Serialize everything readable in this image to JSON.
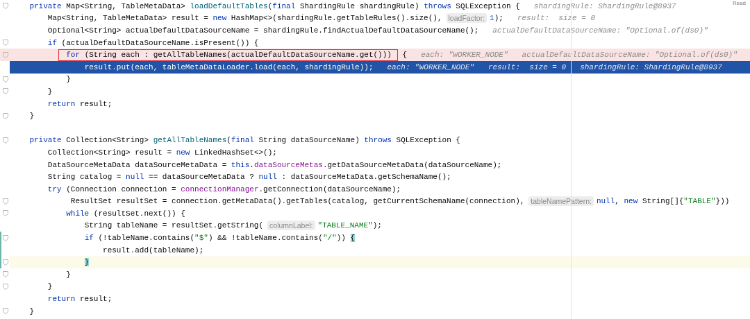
{
  "corner_label": "Read",
  "lines": [
    {
      "kind": "normal",
      "fold": true,
      "changed": false,
      "tokens": [
        {
          "kind": "kw",
          "text": "    private"
        },
        {
          "kind": "p",
          "text": " Map<String, TableMetaData> "
        },
        {
          "kind": "m",
          "text": "loadDefaultTables"
        },
        {
          "kind": "p",
          "text": "("
        },
        {
          "kind": "kw",
          "text": "final"
        },
        {
          "kind": "p",
          "text": " ShardingRule shardingRule) "
        },
        {
          "kind": "kw",
          "text": "throws"
        },
        {
          "kind": "p",
          "text": " SQLException {"
        },
        {
          "kind": "v",
          "text": "shardingRule: ShardingRule@8937"
        }
      ]
    },
    {
      "kind": "normal",
      "fold": false,
      "changed": false,
      "tokens": [
        {
          "kind": "p",
          "text": "        Map<String, TableMetaData> result = "
        },
        {
          "kind": "kw",
          "text": "new"
        },
        {
          "kind": "p",
          "text": " HashMap<>(shardingRule.getTableRules().size(),"
        },
        {
          "kind": "h",
          "text": "loadFactor:"
        },
        {
          "kind": "n",
          "text": "1"
        },
        {
          "kind": "p",
          "text": ");"
        },
        {
          "kind": "v",
          "text": "result:  size = 0"
        }
      ]
    },
    {
      "kind": "normal",
      "fold": false,
      "changed": false,
      "tokens": [
        {
          "kind": "p",
          "text": "        Optional<String> actualDefaultDataSourceName = shardingRule.findActualDefaultDataSourceName();"
        },
        {
          "kind": "v",
          "text": "actualDefaultDataSourceName: \"Optional.of(ds0)\""
        }
      ]
    },
    {
      "kind": "normal",
      "fold": true,
      "changed": false,
      "tokens": [
        {
          "kind": "kw",
          "text": "        if"
        },
        {
          "kind": "p",
          "text": " (actualDefaultDataSourceName.isPresent()) {"
        }
      ]
    },
    {
      "kind": "breakpoint",
      "fold": true,
      "changed": false,
      "tokens": [
        {
          "kind": "group",
          "outlined": true,
          "tokens": [
            {
              "kind": "kw",
              "text": "            for"
            },
            {
              "kind": "p",
              "text": " (String each : getAllTableNames(actualDefaultDataSourceName.get()))"
            }
          ]
        },
        {
          "kind": "p",
          "text": " {"
        },
        {
          "kind": "v",
          "text": "each: \"WORKER_NODE\""
        },
        {
          "kind": "v",
          "text": "actualDefaultDataSourceName: \"Optional.of(ds0)\""
        }
      ]
    },
    {
      "kind": "execution",
      "fold": false,
      "changed": false,
      "tokens": [
        {
          "kind": "p",
          "text": "                result.put(each, tableMetaDataLoader.load(each, shardingRule));"
        },
        {
          "kind": "v",
          "text": "each: \"WORKER_NODE\""
        },
        {
          "kind": "v",
          "text": "result:  size = 0"
        },
        {
          "kind": "v",
          "text": "shardingRule: ShardingRule@8937"
        }
      ]
    },
    {
      "kind": "normal",
      "fold": true,
      "changed": false,
      "tokens": [
        {
          "kind": "p",
          "text": "            }"
        }
      ]
    },
    {
      "kind": "normal",
      "fold": true,
      "changed": false,
      "tokens": [
        {
          "kind": "p",
          "text": "        }"
        }
      ]
    },
    {
      "kind": "normal",
      "fold": false,
      "changed": false,
      "tokens": [
        {
          "kind": "kw",
          "text": "        return"
        },
        {
          "kind": "p",
          "text": " result;"
        }
      ]
    },
    {
      "kind": "normal",
      "fold": true,
      "changed": false,
      "tokens": [
        {
          "kind": "p",
          "text": "    }"
        }
      ]
    },
    {
      "kind": "normal",
      "fold": false,
      "changed": false
    },
    {
      "kind": "normal",
      "fold": true,
      "changed": false,
      "tokens": [
        {
          "kind": "kw",
          "text": "    private"
        },
        {
          "kind": "p",
          "text": " Collection<String> "
        },
        {
          "kind": "m",
          "text": "getAllTableNames"
        },
        {
          "kind": "p",
          "text": "("
        },
        {
          "kind": "kw",
          "text": "final"
        },
        {
          "kind": "p",
          "text": " String dataSourceName) "
        },
        {
          "kind": "kw",
          "text": "throws"
        },
        {
          "kind": "p",
          "text": " SQLException {"
        }
      ]
    },
    {
      "kind": "normal",
      "fold": false,
      "changed": false,
      "tokens": [
        {
          "kind": "p",
          "text": "        Collection<String> result = "
        },
        {
          "kind": "kw",
          "text": "new"
        },
        {
          "kind": "p",
          "text": " LinkedHashSet<>();"
        }
      ]
    },
    {
      "kind": "normal",
      "fold": false,
      "changed": false,
      "tokens": [
        {
          "kind": "p",
          "text": "        DataSourceMetaData dataSourceMetaData = "
        },
        {
          "kind": "kw",
          "text": "this"
        },
        {
          "kind": "p",
          "text": "."
        },
        {
          "kind": "f",
          "text": "dataSourceMetas"
        },
        {
          "kind": "p",
          "text": ".getDataSourceMetaData(dataSourceName);"
        }
      ]
    },
    {
      "kind": "normal",
      "fold": false,
      "changed": false,
      "tokens": [
        {
          "kind": "p",
          "text": "        String catalog = "
        },
        {
          "kind": "kw",
          "text": "null"
        },
        {
          "kind": "p",
          "text": " == dataSourceMetaData ? "
        },
        {
          "kind": "kw",
          "text": "null"
        },
        {
          "kind": "p",
          "text": " : dataSourceMetaData.getSchemaName();"
        }
      ]
    },
    {
      "kind": "normal",
      "fold": false,
      "changed": false,
      "tokens": [
        {
          "kind": "kw",
          "text": "        try"
        },
        {
          "kind": "p",
          "text": " (Connection connection = "
        },
        {
          "kind": "f",
          "text": "connectionManager"
        },
        {
          "kind": "p",
          "text": ".getConnection(dataSourceName);"
        }
      ]
    },
    {
      "kind": "normal",
      "fold": true,
      "changed": false,
      "tokens": [
        {
          "kind": "p",
          "text": "             ResultSet resultSet = connection.getMetaData().getTables(catalog, getCurrentSchemaName(connection),"
        },
        {
          "kind": "h",
          "text": "tableNamePattern:"
        },
        {
          "kind": "kw",
          "text": "null"
        },
        {
          "kind": "p",
          "text": ", "
        },
        {
          "kind": "kw",
          "text": "new"
        },
        {
          "kind": "p",
          "text": " String[]{"
        },
        {
          "kind": "s",
          "text": "\"TABLE\""
        },
        {
          "kind": "p",
          "text": "}))"
        }
      ]
    },
    {
      "kind": "normal",
      "fold": true,
      "changed": false,
      "tokens": [
        {
          "kind": "kw",
          "text": "            while"
        },
        {
          "kind": "p",
          "text": " (resultSet.next()) {"
        }
      ]
    },
    {
      "kind": "normal",
      "fold": false,
      "changed": false,
      "tokens": [
        {
          "kind": "p",
          "text": "                String tableName = resultSet.getString("
        },
        {
          "kind": "h",
          "text": "columnLabel:"
        },
        {
          "kind": "s",
          "text": "\"TABLE_NAME\""
        },
        {
          "kind": "p",
          "text": ");"
        }
      ]
    },
    {
      "kind": "normal",
      "fold": true,
      "changed": true,
      "tokens": [
        {
          "kind": "kw",
          "text": "                if"
        },
        {
          "kind": "p",
          "text": " (!tableName.contains("
        },
        {
          "kind": "s",
          "text": "\"$\""
        },
        {
          "kind": "p",
          "text": ") && !tableName.contains("
        },
        {
          "kind": "s",
          "text": "\"/\""
        },
        {
          "kind": "p",
          "text": ")) "
        },
        {
          "kind": "b",
          "text": "{"
        }
      ]
    },
    {
      "kind": "normal",
      "fold": false,
      "changed": true,
      "tokens": [
        {
          "kind": "p",
          "text": "                    result.add(tableName);"
        }
      ]
    },
    {
      "kind": "caret",
      "fold": true,
      "changed": true,
      "tokens": [
        {
          "kind": "b",
          "text": "                }"
        }
      ]
    },
    {
      "kind": "normal",
      "fold": true,
      "changed": false,
      "tokens": [
        {
          "kind": "p",
          "text": "            }"
        }
      ]
    },
    {
      "kind": "normal",
      "fold": true,
      "changed": false,
      "tokens": [
        {
          "kind": "p",
          "text": "        }"
        }
      ]
    },
    {
      "kind": "normal",
      "fold": false,
      "changed": false,
      "tokens": [
        {
          "kind": "kw",
          "text": "        return"
        },
        {
          "kind": "p",
          "text": " result;"
        }
      ]
    },
    {
      "kind": "normal",
      "fold": true,
      "changed": false,
      "tokens": [
        {
          "kind": "p",
          "text": "    }"
        }
      ]
    }
  ]
}
